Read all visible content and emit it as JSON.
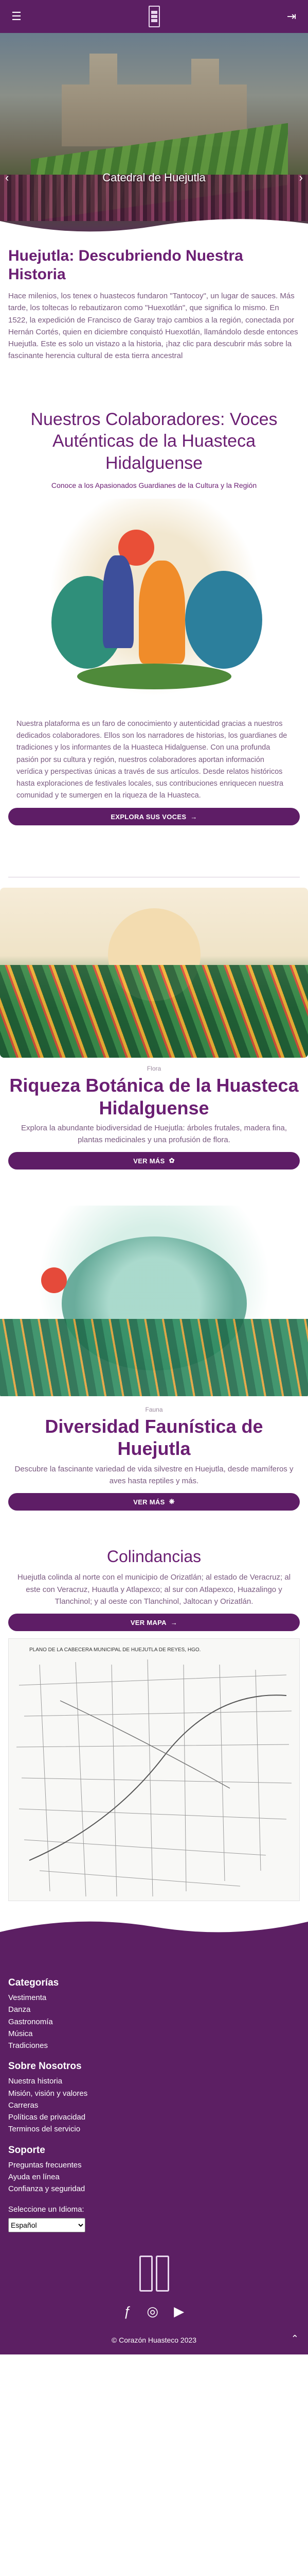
{
  "header": {
    "menu_icon": "menu-icon",
    "login_icon": "login-icon"
  },
  "hero": {
    "caption": "Catedral de Huejutla",
    "prev": "‹",
    "next": "›"
  },
  "intro": {
    "title": "Huejutla: Descubriendo Nuestra Historia",
    "text": "Hace milenios, los teneк o huastecos fundaron \"Tantocoy\", un lugar de sauces. Más tarde, los toltecas lo rebautizaron como \"Huexotlán\", que significa lo mismo. En 1522, la expedición de Francisco de Garay trajo cambios a la región, conectada por Hernán Cortés, quien en diciembre conquistó Huexotlán, llamándolo desde entonces Huejutla. Este es solo un vistazo a la historia, ¡haz clic para descubrir más sobre la fascinante herencia cultural de esta tierra ancestral"
  },
  "collaborators": {
    "title": "Nuestros Colaboradores: Voces Auténticas de la Huasteca Hidalguense",
    "subtitle": "Conoce a los Apasionados Guardianes de la Cultura y la Región",
    "text": "Nuestra plataforma es un faro de conocimiento y autenticidad gracias a nuestros dedicados colaboradores. Ellos son los narradores de historias, los guardianes de tradiciones y los informantes de la Huasteca Hidalguense. Con una profunda pasión por su cultura y región, nuestros colaboradores aportan información verídica y perspectivas únicas a través de sus artículos. Desde relatos históricos hasta exploraciones de festivales locales, sus contribuciones enriquecen nuestra comunidad y te sumergen en la riqueza de la Huasteca.",
    "button": "EXPLORA SUS VOCES"
  },
  "flora": {
    "tag": "Flora",
    "title": "Riqueza Botánica de la Huasteca Hidalguense",
    "text": "Explora la abundante biodiversidad de Huejutla: árboles frutales, madera fina, plantas medicinales y una profusión de flora.",
    "button": "VER MÁS"
  },
  "fauna": {
    "tag": "Fauna",
    "title": "Diversidad Faunística de Huejutla",
    "text": "Descubre la fascinante variedad de vida silvestre en Huejutla, desde mamíferos y aves hasta reptiles y más.",
    "button": "VER MÁS"
  },
  "colindancias": {
    "title": "Colindancias",
    "text": "Huejutla colinda al norte con el municipio de Orizatlán; al estado de Veracruz; al este con Veracruz, Huautla y Atlapexco; al sur con Atlapexco, Huazalingo y Tlanchinol; y al oeste con Tlanchinol, Jaltocan y Orizatlán.",
    "button": "VER MAPA",
    "map_title": "PLANO DE LA CABECERA MUNICIPAL DE HUEJUTLA DE REYES, HGO."
  },
  "footer": {
    "categories_title": "Categorías",
    "categories": [
      "Vestimenta",
      "Danza",
      "Gastronomía",
      "Música",
      "Tradiciones"
    ],
    "about_title": "Sobre Nosotros",
    "about": [
      "Nuestra historia",
      "Misión, visión y valores",
      "Carreras",
      "Políticas de privacidad",
      "Terminos del servicio"
    ],
    "support_title": "Soporte",
    "support": [
      "Preguntas frecuentes",
      "Ayuda en línea",
      "Confianza y seguridad"
    ],
    "language_label": "Seleccione un Idioma:",
    "language_value": "Español",
    "copyright": "© Corazón Huasteco 2023"
  },
  "colors": {
    "brand": "#5c1f63",
    "title": "#6b1f73",
    "text": "#7a5a80"
  }
}
